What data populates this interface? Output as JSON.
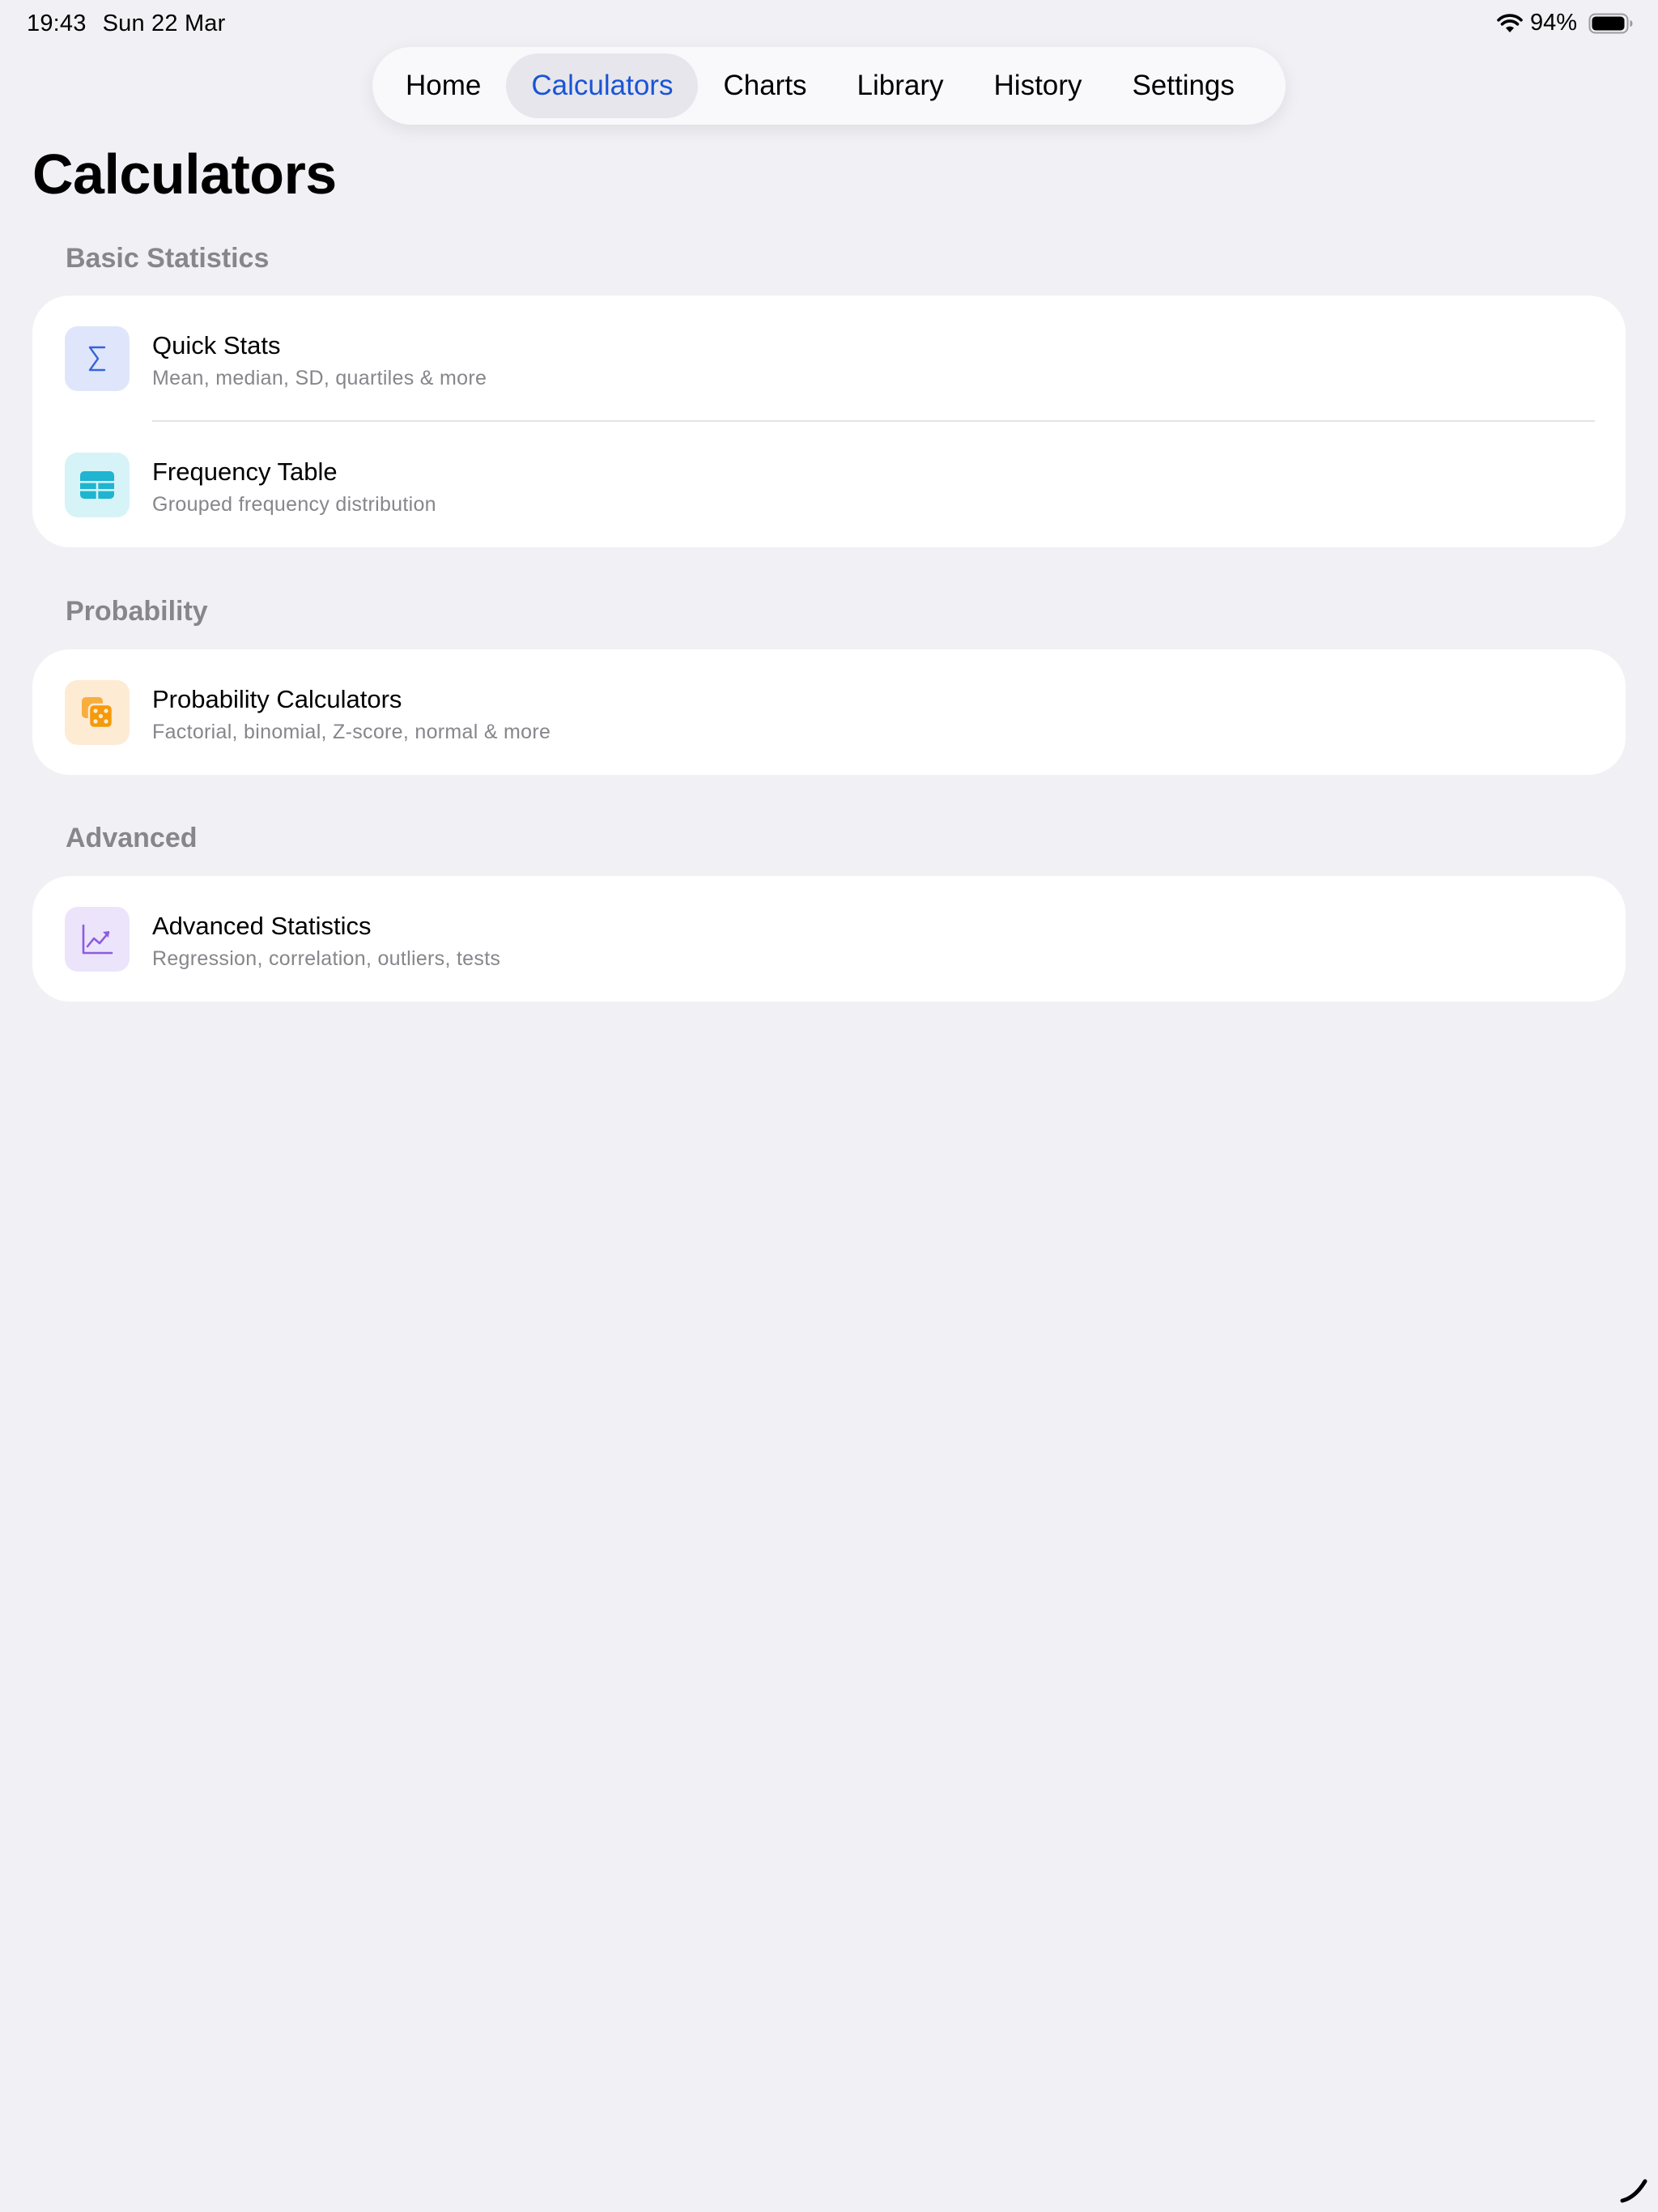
{
  "status_bar": {
    "time": "19:43",
    "date": "Sun 22 Mar",
    "battery": "94%"
  },
  "tabs": [
    {
      "label": "Home"
    },
    {
      "label": "Calculators"
    },
    {
      "label": "Charts"
    },
    {
      "label": "Library"
    },
    {
      "label": "History"
    },
    {
      "label": "Settings"
    }
  ],
  "active_tab": "Calculators",
  "page_title": "Calculators",
  "sections": [
    {
      "header": "Basic Statistics",
      "items": [
        {
          "title": "Quick Stats",
          "subtitle": "Mean, median, SD, quartiles & more",
          "icon": "sigma-icon"
        },
        {
          "title": "Frequency Table",
          "subtitle": "Grouped frequency distribution",
          "icon": "table-icon"
        }
      ]
    },
    {
      "header": "Probability",
      "items": [
        {
          "title": "Probability Calculators",
          "subtitle": "Factorial, binomial, Z-score, normal & more",
          "icon": "dice-icon"
        }
      ]
    },
    {
      "header": "Advanced",
      "items": [
        {
          "title": "Advanced Statistics",
          "subtitle": "Regression, correlation, outliers, tests",
          "icon": "chart-trend-icon"
        }
      ]
    }
  ],
  "colors": {
    "background": "#f0f0f5",
    "accent": "#1a54d6",
    "secondary_text": "#86868b",
    "sigma_bg": "#dfe6fb",
    "sigma_fg": "#3764d8",
    "table_bg": "#d6f3f7",
    "table_fg": "#1fb4d0",
    "dice_bg": "#fdebd4",
    "dice_fg": "#f59a0c",
    "trend_bg": "#ece4fb",
    "trend_fg": "#8c5ce0"
  }
}
